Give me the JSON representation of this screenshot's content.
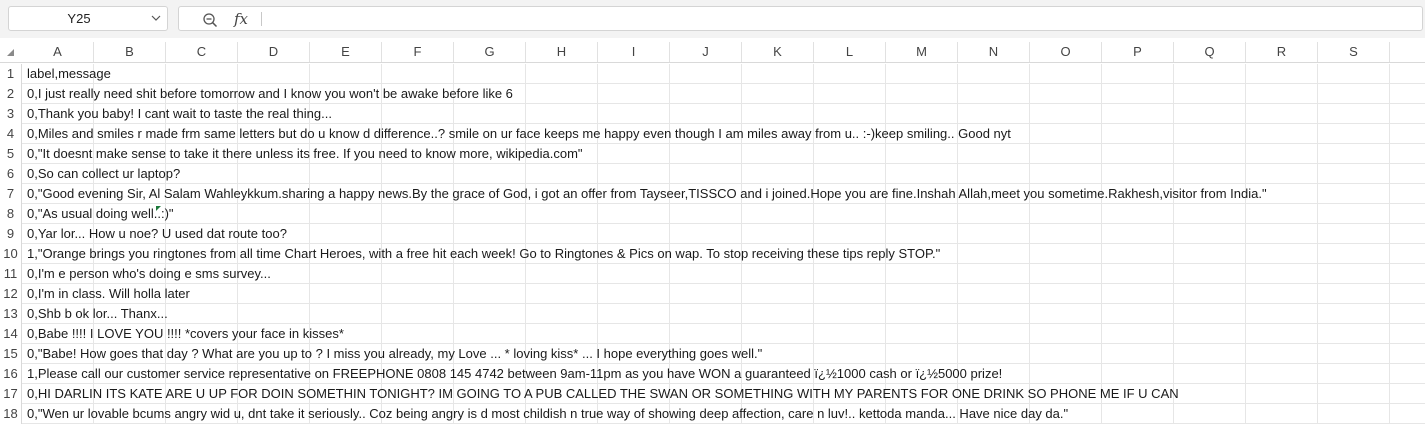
{
  "formula_bar": {
    "name_box": "Y25",
    "fx_label": "fx",
    "formula": ""
  },
  "columns": [
    "A",
    "B",
    "C",
    "D",
    "E",
    "F",
    "G",
    "H",
    "I",
    "J",
    "K",
    "L",
    "M",
    "N",
    "O",
    "P",
    "Q",
    "R",
    "S"
  ],
  "rows": [
    {
      "num": "1",
      "text": "label,message"
    },
    {
      "num": "2",
      "text": "0,I just really need shit before tomorrow and I know you won't be awake before like 6"
    },
    {
      "num": "3",
      "text": "0,Thank you baby! I cant wait to taste the real thing..."
    },
    {
      "num": "4",
      "text": "0,Miles and smiles r made frm same letters but do u know d difference..? smile on ur face keeps me happy even though I am miles away from u.. :-)keep smiling.. Good nyt"
    },
    {
      "num": "5",
      "text": "0,\"It doesnt make sense to take it there unless its free. If you need to know more, wikipedia.com\""
    },
    {
      "num": "6",
      "text": "0,So can collect ur laptop?"
    },
    {
      "num": "7",
      "text": "0,\"Good evening Sir, Al Salam Wahleykkum.sharing a happy news.By the grace of God, i got an offer from Tayseer,TISSCO and i joined.Hope you are fine.Inshah Allah,meet you sometime.Rakhesh,visitor from India.\""
    },
    {
      "num": "8",
      "text": "0,\"As usual  doing well..:)\""
    },
    {
      "num": "9",
      "text": "0,Yar lor... How u noe? U used dat route too?"
    },
    {
      "num": "10",
      "text": "1,\"Orange brings you ringtones from all time Chart Heroes, with a free hit each week! Go to Ringtones & Pics on wap. To stop receiving these tips reply STOP.\""
    },
    {
      "num": "11",
      "text": "0,I'm e person who's doing e sms survey..."
    },
    {
      "num": "12",
      "text": "0,I'm in class. Will holla later"
    },
    {
      "num": "13",
      "text": "0,Shb b ok lor... Thanx..."
    },
    {
      "num": "14",
      "text": "0,Babe !!!! I LOVE YOU !!!! *covers your face in kisses*"
    },
    {
      "num": "15",
      "text": "0,\"Babe! How goes that day ? What are you up to ? I miss you already, my Love ... * loving kiss* ... I hope everything goes well.\""
    },
    {
      "num": "16",
      "text": "1,Please call our customer service representative on FREEPHONE 0808 145 4742 between 9am-11pm as you have WON a guaranteed ï¿½1000 cash or ï¿½5000 prize!"
    },
    {
      "num": "17",
      "text": "0,HI DARLIN ITS KATE ARE U UP FOR DOIN SOMETHIN TONIGHT? IM GOING TO A PUB CALLED THE SWAN OR SOMETHING WITH MY PARENTS FOR ONE DRINK SO PHONE ME IF U CAN"
    },
    {
      "num": "18",
      "text": "0,\"Wen ur lovable bcums angry wid u, dnt take it seriously.. Coz being angry is d most childish n true way of showing deep affection, care n luv!.. kettoda manda... Have nice day da.\""
    }
  ],
  "colors": {
    "header_bg": "#f3f3f3",
    "grid_line": "#e6e6e6",
    "marker": "#1e7a3c"
  }
}
